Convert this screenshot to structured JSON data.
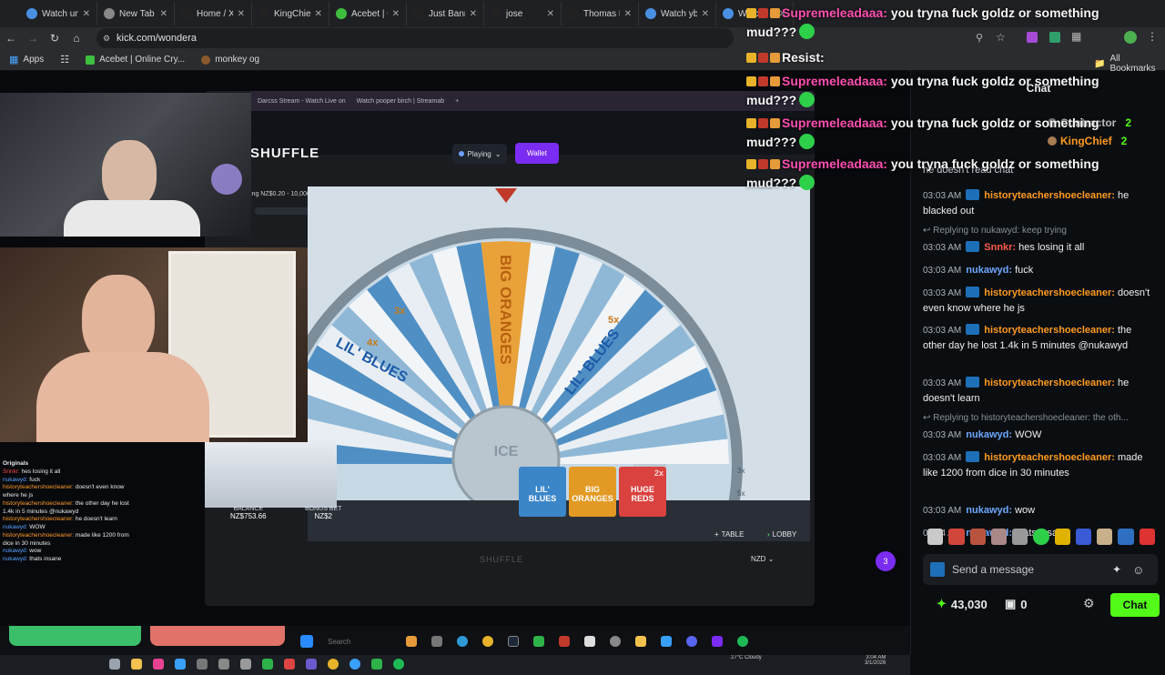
{
  "browser": {
    "tabs": [
      {
        "label": "Watch un",
        "color": "#4a90e2"
      },
      {
        "label": "New Tab",
        "color": "#888888"
      },
      {
        "label": "Home / X",
        "color": "#222222"
      },
      {
        "label": "KingChief",
        "color": "#222222"
      },
      {
        "label": "Acebet | O",
        "color": "#3fbf3f"
      },
      {
        "label": "Just Banne",
        "color": "#222222"
      },
      {
        "label": "jose",
        "color": "#222222"
      },
      {
        "label": "Thomas K",
        "color": "#222222"
      },
      {
        "label": "Watch yb",
        "color": "#4a90e2"
      },
      {
        "label": "Watchn",
        "color": "#4a90e2"
      }
    ],
    "url": "kick.com/wondera",
    "bookmarks": {
      "apps": "Apps",
      "acebet": "Acebet | Online Cry...",
      "monkey": "monkey og",
      "all": "All Bookmarks"
    }
  },
  "stream": {
    "inner_tab1": "Darcss Stream - Watch Live on",
    "inner_tab2": "Watch pooper birch | Streamab",
    "logo": "SHUFFLE",
    "bet_range": "ing NZ$0.20 - 10,000",
    "playing": "Playing",
    "wallet": "Wallet",
    "wheel_labels": [
      "BIG ORANGES",
      "LIL' BLUES",
      "LIL' BLUES",
      "ICE"
    ],
    "multipliers": [
      "3x",
      "4x",
      "5x",
      "2x",
      "3x",
      "5x"
    ],
    "cards": [
      "LIL' BLUES",
      "BIG ORANGES",
      "HUGE REDS"
    ],
    "card_multiplier": "2x",
    "balance_label": "BALANCE",
    "balance_value": "NZ$753.66",
    "bonus_label": "BONUS BET",
    "bonus_value": "NZ$2",
    "table": "TABLE",
    "lobby": "LOBBY",
    "footer_logo": "SHUFFLE",
    "currency": "NZD",
    "floating_badge": "3"
  },
  "overlay_chat": {
    "header": "Originals",
    "lines": [
      {
        "user": "Snnkr:",
        "text": "hes losing it all"
      },
      {
        "user": "nukawyd:",
        "text": "fuck"
      },
      {
        "user": "historyteachershoecleaner:",
        "text": "doesn't even know where he js"
      },
      {
        "user": "historyteachershoecleaner:",
        "text": "the other day he lost 1.4k in 5 minutes @nukawyd"
      },
      {
        "user": "historyteachershoecleaner:",
        "text": "he doesn't learn"
      },
      {
        "user": "nukawyd:",
        "text": "WOW"
      },
      {
        "user": "historyteachershoecleaner:",
        "text": "made like 1200 from dice in 30 minutes"
      },
      {
        "user": "nukawyd:",
        "text": "wow"
      },
      {
        "user": "nukawyd:",
        "text": "thats insane"
      }
    ]
  },
  "taskbar": {
    "weather": "27°C Cloudy",
    "time": "3:04 AM",
    "date": "3/1/2026",
    "search": "Search"
  },
  "floating_chat": [
    {
      "user": "Supremeleadaaa:",
      "text": "you tryna fuck goldz or something mud???"
    },
    {
      "user": "Resist:",
      "text": ""
    },
    {
      "user": "Supremeleadaaa:",
      "text": "you tryna fuck goldz or something mud???"
    },
    {
      "user": "Supremeleadaaa:",
      "text": "you tryna fuck goldz or something mud???"
    },
    {
      "user": "Supremeleadaaa:",
      "text": "you tryna fuck goldz or something mud???"
    }
  ],
  "chat": {
    "title": "Chat",
    "leaderboard": [
      {
        "name": "Contractor",
        "count": "2"
      },
      {
        "name": "KingChief",
        "count": "2"
      }
    ],
    "partial_top": "he doesn't read chat",
    "messages": [
      {
        "time": "03:03 AM",
        "user": "historyteachershoecleaner:",
        "text": "he blacked out",
        "color": "o",
        "badge": true
      },
      {
        "reply": "Replying to nukawyd: keep trying"
      },
      {
        "time": "03:03 AM",
        "user": "Snnkr:",
        "text": "hes losing it all",
        "color": "r",
        "badge": true
      },
      {
        "time": "03:03 AM",
        "user": "nukawyd:",
        "text": "fuck",
        "color": "b",
        "badge": false
      },
      {
        "time": "03:03 AM",
        "user": "historyteachershoecleaner:",
        "text": "doesn't even know where he js",
        "color": "o",
        "badge": true
      },
      {
        "time": "03:03 AM",
        "user": "historyteachershoecleaner:",
        "text": "the other day he lost 1.4k in 5 minutes @nukawyd",
        "color": "o",
        "badge": true
      },
      {
        "time": "03:03 AM",
        "user": "historyteachershoecleaner:",
        "text": "he doesn't learn",
        "color": "o",
        "badge": true
      },
      {
        "reply": "Replying to historyteachershoecleaner: the oth..."
      },
      {
        "time": "03:03 AM",
        "user": "nukawyd:",
        "text": "WOW",
        "color": "b",
        "badge": false
      },
      {
        "time": "03:03 AM",
        "user": "historyteachershoecleaner:",
        "text": "made like 1200 from dice in 30 minutes",
        "color": "o",
        "badge": true
      },
      {
        "time": "03:03 AM",
        "user": "nukawyd:",
        "text": "wow",
        "color": "b",
        "badge": false
      },
      {
        "time": "03:04 AM",
        "user": "nukawyd:",
        "text": "thats insane",
        "color": "b",
        "badge": false
      }
    ],
    "input_placeholder": "Send a message",
    "points": "43,030",
    "bag_count": "0",
    "chat_button": "Chat",
    "accent": "#53fc18"
  }
}
